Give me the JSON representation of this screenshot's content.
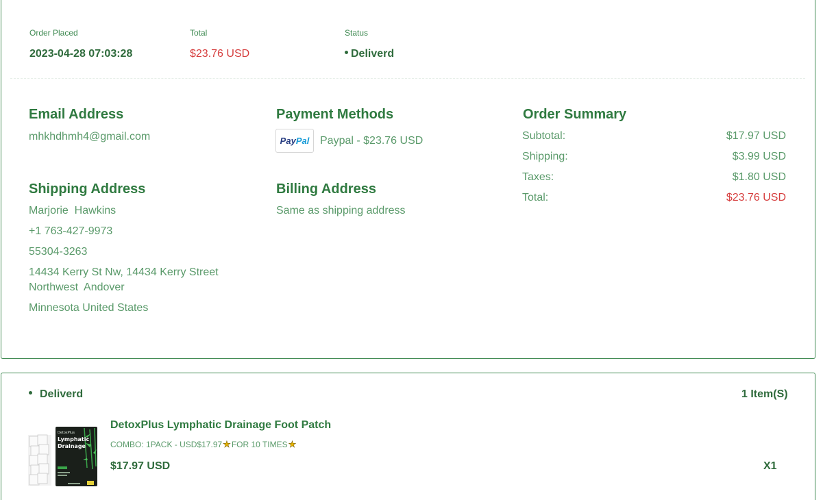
{
  "order": {
    "placed_label": "Order Placed",
    "placed_value": "2023-04-28 07:03:28",
    "total_label": "Total",
    "total_value": "$23.76 USD",
    "status_label": "Status",
    "status_value": "Deliverd"
  },
  "email": {
    "title": "Email Address",
    "value": "mhkhdhmh4@gmail.com"
  },
  "payment": {
    "title": "Payment Methods",
    "logo_text_1": "Pay",
    "logo_text_2": "Pal",
    "value": "Paypal - $23.76 USD"
  },
  "summary": {
    "title": "Order Summary",
    "rows": [
      {
        "label": "Subtotal:",
        "value": "$17.97 USD"
      },
      {
        "label": "Shipping:",
        "value": "$3.99 USD"
      },
      {
        "label": "Taxes:",
        "value": "$1.80 USD"
      },
      {
        "label": "Total:",
        "value": "$23.76 USD"
      }
    ]
  },
  "shipping": {
    "title": "Shipping Address",
    "name": "Marjorie  Hawkins",
    "phone": "+1 763-427-9973",
    "zip": "55304-3263",
    "street_line1": "14434 Kerry St Nw, 14434 Kerry Street",
    "street_line2": "Northwest  Andover",
    "region": "Minnesota United States"
  },
  "billing": {
    "title": "Billing Address",
    "value": "Same as shipping address"
  },
  "shipment": {
    "status": "Deliverd",
    "items_count": "1 Item(S)",
    "product": {
      "name": "DetoxPlus Lymphatic Drainage Foot Patch",
      "variant_prefix": "COMBO: 1PACK - USD$17.97",
      "variant_suffix": "FOR 10 TIMES",
      "image_text_brand": "DetoxPlus",
      "image_text_title": "Lymphatic Drainage",
      "price": "$17.97 USD",
      "quantity": "X1"
    }
  },
  "colors": {
    "accent": "#3f8a52",
    "price_red": "#d63d3d",
    "paypal_dark": "#253b80",
    "paypal_light": "#179bd7"
  }
}
